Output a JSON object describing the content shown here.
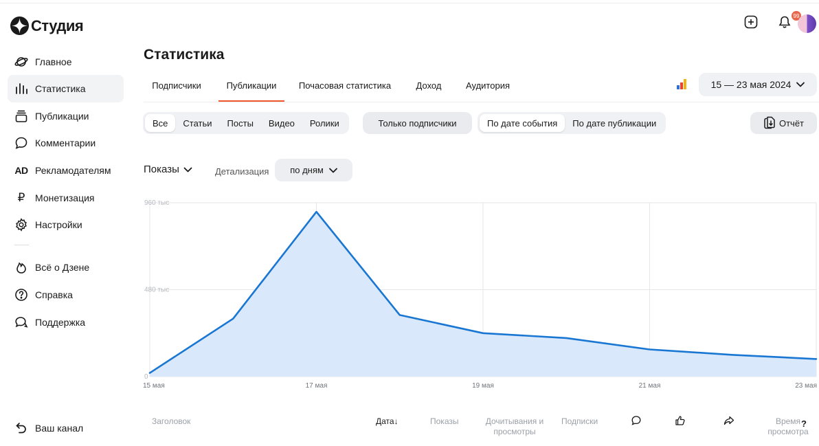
{
  "app": {
    "logo_text": "Студия"
  },
  "sidebar": {
    "items": [
      {
        "label": "Главное",
        "icon": "planet-icon"
      },
      {
        "label": "Статистика",
        "icon": "stats-icon",
        "active": true
      },
      {
        "label": "Публикации",
        "icon": "publications-icon"
      },
      {
        "label": "Комментарии",
        "icon": "comment-icon"
      },
      {
        "label": "Рекламодателям",
        "icon": "ad-icon",
        "glyph": "AD"
      },
      {
        "label": "Монетизация",
        "icon": "ruble-icon",
        "glyph": "₽"
      },
      {
        "label": "Настройки",
        "icon": "gear-icon"
      }
    ],
    "extra": [
      {
        "label": "Всё о Дзене",
        "icon": "flame-icon"
      },
      {
        "label": "Справка",
        "icon": "question-icon"
      },
      {
        "label": "Поддержка",
        "icon": "support-icon"
      }
    ],
    "channel": {
      "label": "Ваш канал",
      "icon": "back-arrow-icon"
    }
  },
  "header": {
    "title": "Статистика",
    "notifications_badge": "99"
  },
  "tabs": [
    "Подписчики",
    "Публикации",
    "Почасовая статистика",
    "Доход",
    "Аудитория"
  ],
  "active_tab": "Публикации",
  "date_range": "15 — 23 мая 2024",
  "filters": {
    "types": [
      "Все",
      "Статьи",
      "Посты",
      "Видео",
      "Ролики"
    ],
    "subscribers_only": "Только подписчики",
    "date_modes": [
      "По дате события",
      "По дате публикации"
    ],
    "report": "Отчёт"
  },
  "metric": {
    "label": "Показы",
    "detail_label": "Детализация",
    "detail_value": "по дням"
  },
  "chart_data": {
    "type": "area",
    "x": [
      "15 мая",
      "16 мая",
      "17 мая",
      "18 мая",
      "19 мая",
      "20 мая",
      "21 мая",
      "22 мая",
      "23 мая"
    ],
    "x_tick_labels": [
      "15 мая",
      "17 мая",
      "19 мая",
      "21 мая",
      "23 мая"
    ],
    "y_tick_labels": [
      "960 тыс",
      "480 тыс",
      "0"
    ],
    "ylim": [
      0,
      960000
    ],
    "series": [
      {
        "values": [
          20000,
          320000,
          910000,
          340000,
          240000,
          213000,
          150000,
          120000,
          97000
        ]
      }
    ],
    "colors": {
      "line": "#1976d2",
      "fill": "#d9e9fb",
      "grid": "#e6e6e6"
    },
    "grid": true
  },
  "table": {
    "columns": [
      "Заголовок",
      "Дата",
      "Показы",
      "Дочитывания и просмотры",
      "Подписки",
      "Время просмотра"
    ],
    "sort_arrow": "↓",
    "icon_columns": [
      "comment-icon",
      "like-icon",
      "share-icon"
    ],
    "help": "?"
  }
}
